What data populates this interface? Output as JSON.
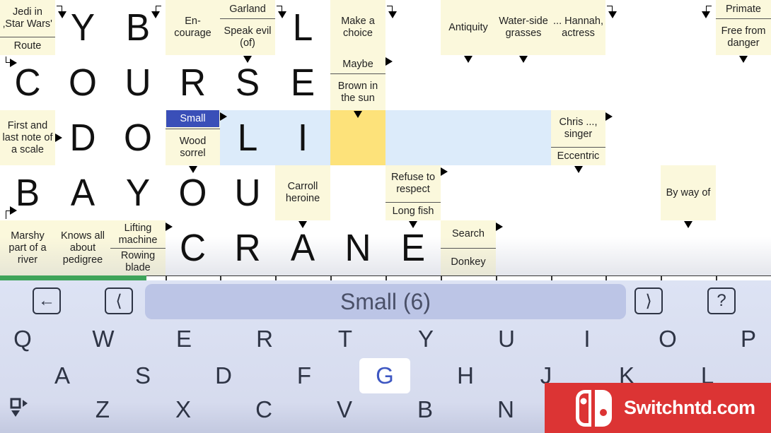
{
  "colors": {
    "clue_bg": "#fbf8dc",
    "active_word": "#dcebfa",
    "active_cell": "#fde27a",
    "selected_clue": "#3a4fb8",
    "keyboard_bg": "#dde3f4",
    "watermark": "#dc3434"
  },
  "grid": [
    [
      {
        "type": "split",
        "top": "Jedi in ‚Star Wars'",
        "bottom": "Route"
      },
      {
        "type": "letter",
        "letter": "Y",
        "arrow": "hook-down-left"
      },
      {
        "type": "letter",
        "letter": "B",
        "arrow": "hook-down-right"
      },
      {
        "type": "clue",
        "text": "En-courage"
      },
      {
        "type": "split",
        "top": "Garland",
        "bottom": "Speak evil (of)"
      },
      {
        "type": "letter",
        "letter": "L",
        "arrow": "hook-down-left"
      },
      {
        "type": "clue",
        "text": "Make a choice"
      },
      {
        "type": "letter",
        "letter": "",
        "arrow": "hook-down-left"
      },
      {
        "type": "clue",
        "text": "Antiquity"
      },
      {
        "type": "clue",
        "text": "Water-side grasses"
      },
      {
        "type": "clue",
        "text": "... Hannah, actress"
      },
      {
        "type": "letter",
        "letter": "",
        "arrow": "hook-down-left"
      },
      {
        "type": "letter",
        "letter": "",
        "arrow": "hook-down-right"
      },
      {
        "type": "split",
        "top": "Primate",
        "bottom": "Free from danger"
      }
    ],
    [
      {
        "type": "letter",
        "letter": "C",
        "arrow": "hook-right"
      },
      {
        "type": "letter",
        "letter": "O"
      },
      {
        "type": "letter",
        "letter": "U"
      },
      {
        "type": "letter",
        "letter": "R"
      },
      {
        "type": "letter",
        "letter": "S",
        "arrow": "down"
      },
      {
        "type": "letter",
        "letter": "E"
      },
      {
        "type": "split",
        "top": "Maybe",
        "bottom": "Brown in the sun"
      },
      {
        "type": "letter",
        "letter": "",
        "arrow": "right"
      },
      {
        "type": "letter",
        "letter": "",
        "arrow": "down"
      },
      {
        "type": "letter",
        "letter": "",
        "arrow": "down"
      },
      {
        "type": "letter",
        "letter": ""
      },
      {
        "type": "letter",
        "letter": ""
      },
      {
        "type": "letter",
        "letter": ""
      },
      {
        "type": "letter",
        "letter": "",
        "arrow": "down"
      }
    ],
    [
      {
        "type": "clue",
        "text": "First and last note of a scale"
      },
      {
        "type": "letter",
        "letter": "D",
        "arrow": "right-mid"
      },
      {
        "type": "letter",
        "letter": "O"
      },
      {
        "type": "split",
        "top": "Small",
        "bottom": "Wood sorrel",
        "selected": "top"
      },
      {
        "type": "letter",
        "letter": "L",
        "state": "blue",
        "arrow": "right"
      },
      {
        "type": "letter",
        "letter": "I",
        "state": "blue"
      },
      {
        "type": "letter",
        "letter": "",
        "state": "yellow",
        "arrow": "down"
      },
      {
        "type": "letter",
        "letter": "",
        "state": "blue"
      },
      {
        "type": "letter",
        "letter": "",
        "state": "blue"
      },
      {
        "type": "letter",
        "letter": "",
        "state": "blue"
      },
      {
        "type": "split",
        "top": "Chris ..., singer",
        "bottom": "Eccentric"
      },
      {
        "type": "letter",
        "letter": "",
        "arrow": "right"
      },
      {
        "type": "letter",
        "letter": ""
      },
      {
        "type": "letter",
        "letter": ""
      }
    ],
    [
      {
        "type": "letter",
        "letter": "B",
        "arrow": "hook-right-bottom"
      },
      {
        "type": "letter",
        "letter": "A"
      },
      {
        "type": "letter",
        "letter": "Y"
      },
      {
        "type": "letter",
        "letter": "O",
        "arrow": "down"
      },
      {
        "type": "letter",
        "letter": "U"
      },
      {
        "type": "clue",
        "text": "Carroll heroine"
      },
      {
        "type": "letter",
        "letter": ""
      },
      {
        "type": "split",
        "top": "Refuse to respect",
        "bottom": "Long fish"
      },
      {
        "type": "letter",
        "letter": "",
        "arrow": "right"
      },
      {
        "type": "letter",
        "letter": ""
      },
      {
        "type": "letter",
        "letter": "",
        "arrow": "down"
      },
      {
        "type": "letter",
        "letter": ""
      },
      {
        "type": "clue",
        "text": "By way of"
      },
      {
        "type": "letter",
        "letter": ""
      }
    ],
    [
      {
        "type": "clue",
        "text": "Marshy part of a river"
      },
      {
        "type": "clue",
        "text": "Knows all about pedigree"
      },
      {
        "type": "split",
        "top": "Lifting machine",
        "bottom": "Rowing blade"
      },
      {
        "type": "letter",
        "letter": "C",
        "arrow": "right"
      },
      {
        "type": "letter",
        "letter": "R"
      },
      {
        "type": "letter",
        "letter": "A",
        "arrow": "down"
      },
      {
        "type": "letter",
        "letter": "N"
      },
      {
        "type": "letter",
        "letter": "E",
        "arrow": "down"
      },
      {
        "type": "split",
        "top": "Search",
        "bottom": "Donkey"
      },
      {
        "type": "letter",
        "letter": "",
        "arrow": "right"
      },
      {
        "type": "letter",
        "letter": ""
      },
      {
        "type": "letter",
        "letter": ""
      },
      {
        "type": "letter",
        "letter": "",
        "arrow": "down"
      },
      {
        "type": "letter",
        "letter": ""
      }
    ]
  ],
  "toolbar": {
    "back_icon": "arrow-left-icon",
    "prev_icon": "chevron-left-icon",
    "next_icon": "chevron-right-icon",
    "help_label": "?",
    "current_clue": "Small (6)"
  },
  "keyboard": {
    "rows": [
      [
        "Q",
        "W",
        "E",
        "R",
        "T",
        "Y",
        "U",
        "I",
        "O",
        "P"
      ],
      [
        "A",
        "S",
        "D",
        "F",
        "G",
        "H",
        "J",
        "K",
        "L"
      ],
      [
        "Z",
        "X",
        "C",
        "V",
        "B",
        "N"
      ]
    ],
    "highlighted": "G",
    "layout_icon": "keyboard-layout-icon"
  },
  "watermark": {
    "text": "Switchntd.com",
    "logo": "nintendo-switch-logo"
  }
}
